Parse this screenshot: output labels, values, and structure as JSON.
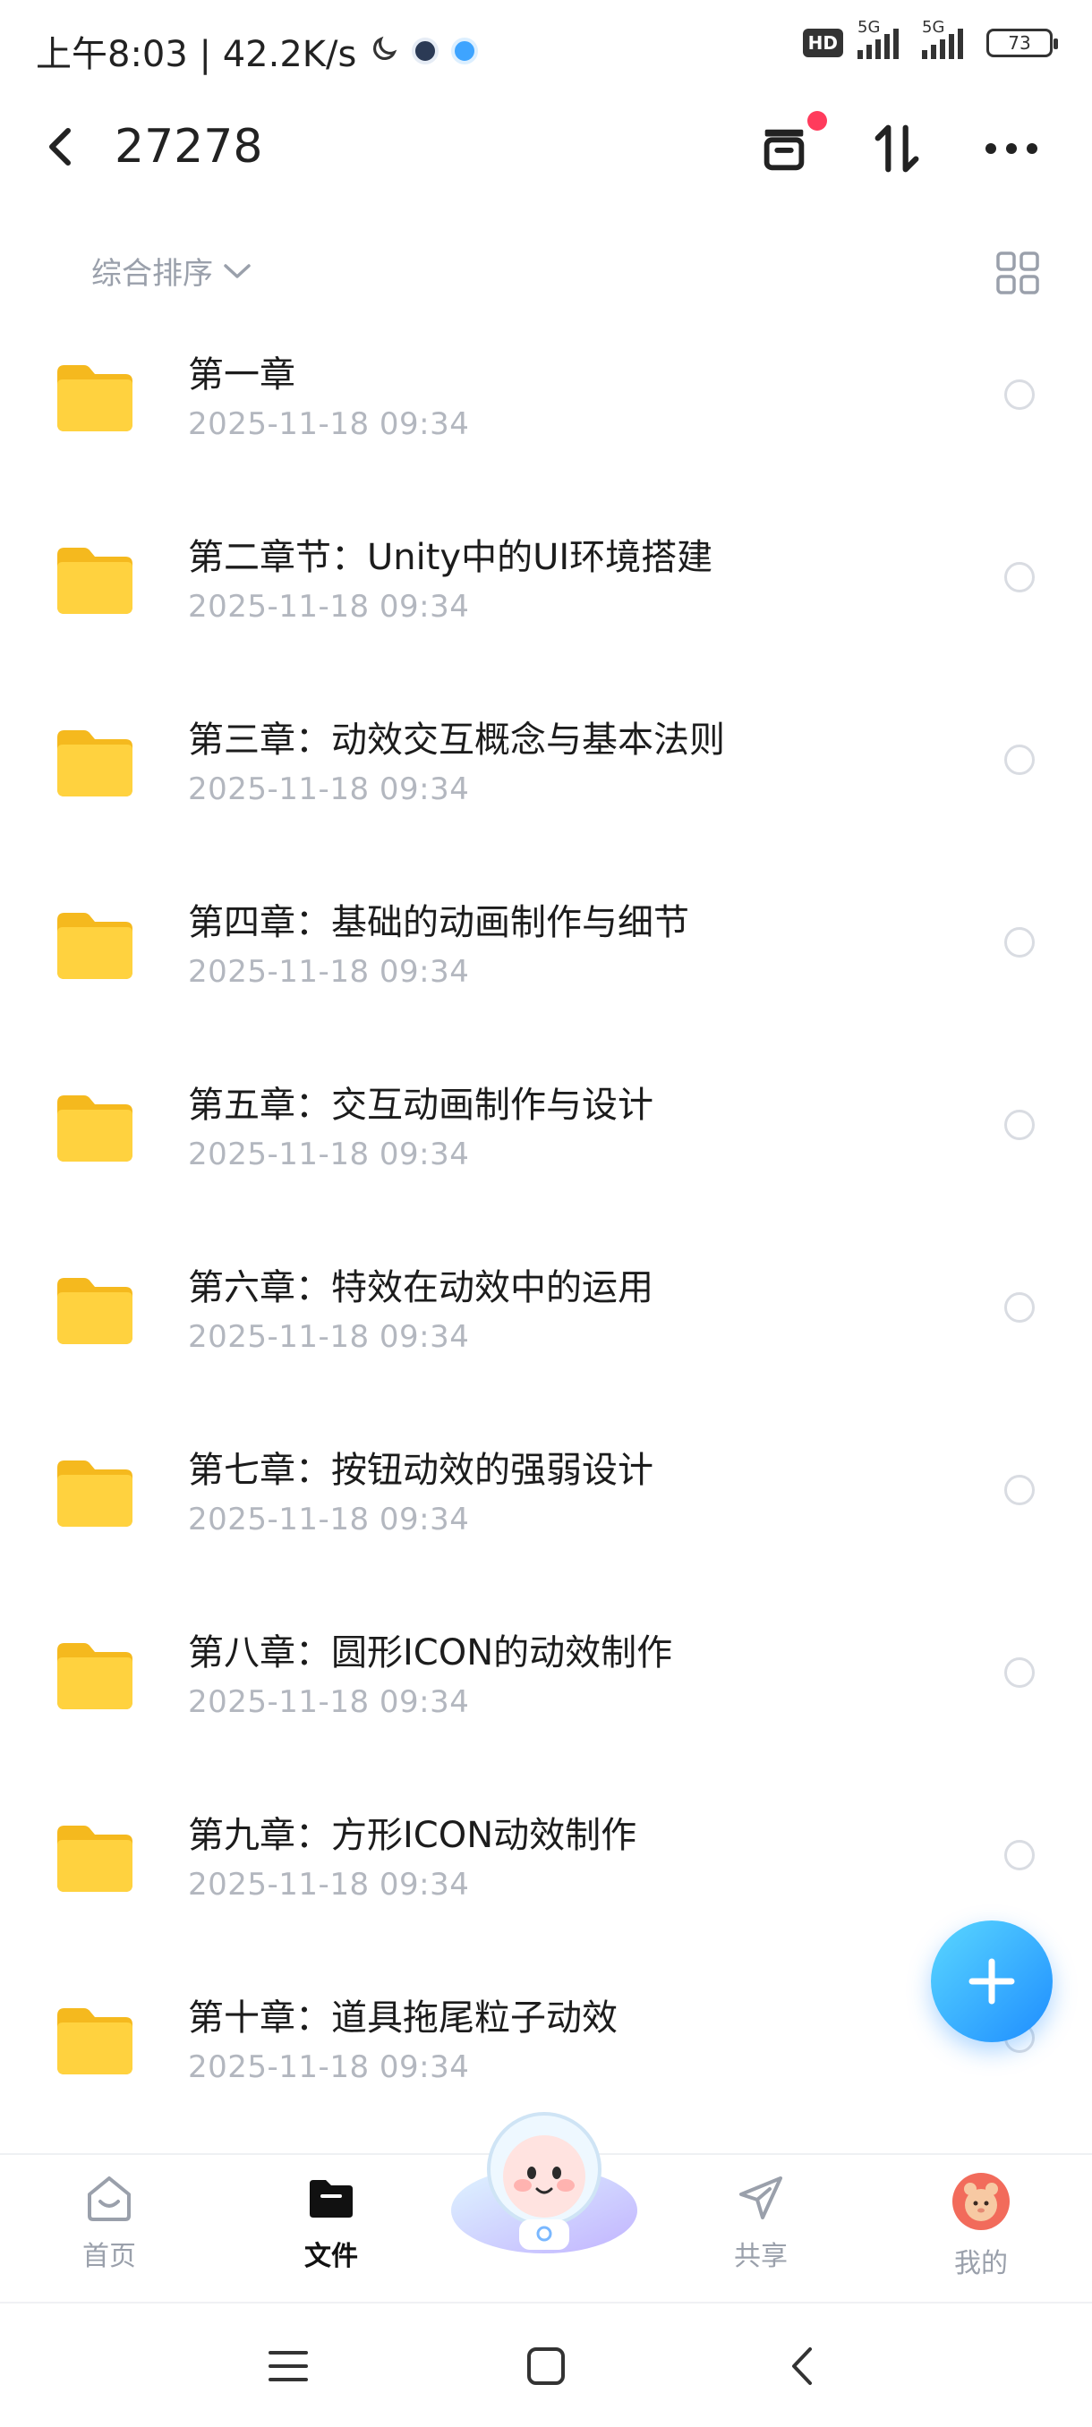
{
  "status_bar": {
    "time": "上午8:03 | 42.2K/s",
    "hd": "HD",
    "network1": "5G",
    "network2": "5G",
    "battery": "73"
  },
  "header": {
    "title": "27278"
  },
  "toolbar": {
    "sort_label": "综合排序"
  },
  "files": [
    {
      "name": "第一章",
      "date": "2025-11-18  09:34"
    },
    {
      "name": "第二章节：Unity中的UI环境搭建",
      "date": "2025-11-18  09:34"
    },
    {
      "name": "第三章：动效交互概念与基本法则",
      "date": "2025-11-18  09:34"
    },
    {
      "name": "第四章：基础的动画制作与细节",
      "date": "2025-11-18  09:34"
    },
    {
      "name": "第五章：交互动画制作与设计",
      "date": "2025-11-18  09:34"
    },
    {
      "name": "第六章：特效在动效中的运用",
      "date": "2025-11-18  09:34"
    },
    {
      "name": "第七章：按钮动效的强弱设计",
      "date": "2025-11-18  09:34"
    },
    {
      "name": "第八章：圆形ICON的动效制作",
      "date": "2025-11-18  09:34"
    },
    {
      "name": "第九章：方形ICON动效制作",
      "date": "2025-11-18  09:34"
    },
    {
      "name": "第十章：道具拖尾粒子动效",
      "date": "2025-11-18  09:34"
    }
  ],
  "bottom_nav": {
    "home": "首页",
    "files": "文件",
    "share": "共享",
    "mine": "我的"
  },
  "colors": {
    "folder": "#FFD23F",
    "fab": "#1E8DFF",
    "notification_dot": "#FF3B5C",
    "muted_text": "#9AA0AB"
  },
  "icons": [
    "back-icon",
    "archive-icon",
    "sort-icon",
    "more-icon",
    "chevron-down-icon",
    "grid-view-icon",
    "folder-icon",
    "plus-icon",
    "home-icon",
    "files-icon",
    "share-icon",
    "avatar",
    "menu-icon",
    "square-icon",
    "back-nav-icon"
  ]
}
